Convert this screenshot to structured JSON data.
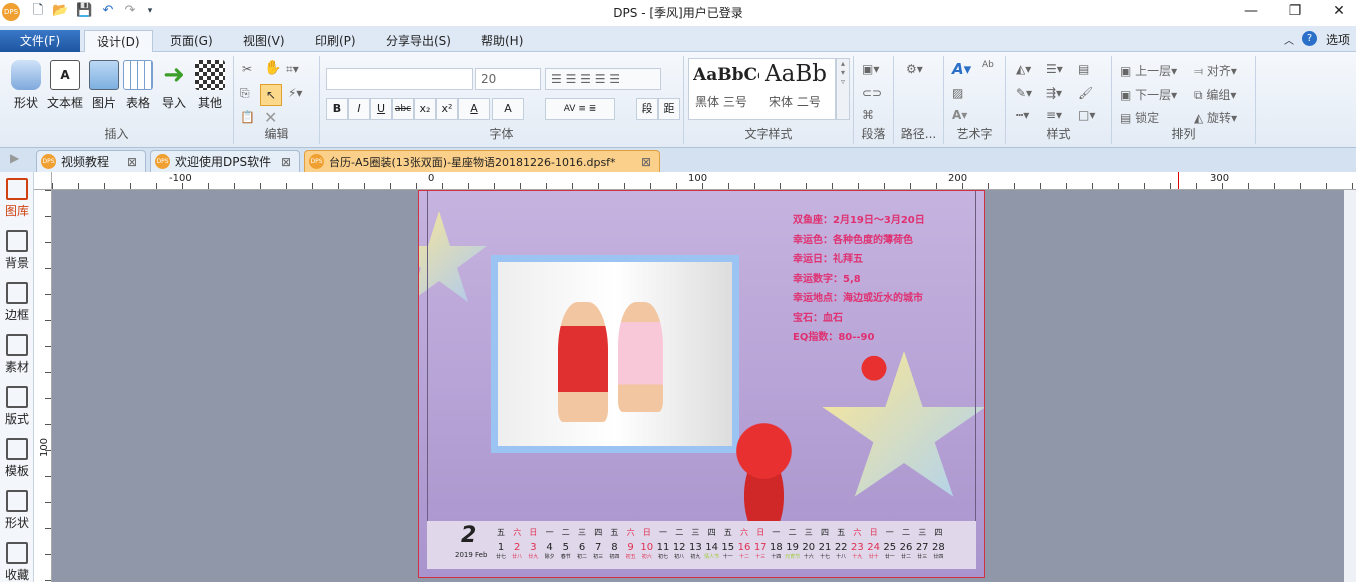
{
  "app": {
    "title": "DPS - [季风]用户已登录",
    "logo": "DPS"
  },
  "quick_access": [
    "new-icon",
    "open-icon",
    "save-icon",
    "undo-icon",
    "redo-icon",
    "customize-icon"
  ],
  "window_controls": {
    "minimize": "—",
    "restore": "❐",
    "close": "✕"
  },
  "menu": {
    "file": "文件(F)",
    "tabs": [
      "设计(D)",
      "页面(G)",
      "视图(V)",
      "印刷(P)",
      "分享导出(S)",
      "帮助(H)"
    ],
    "active": "设计(D)",
    "options": "选项"
  },
  "ribbon": {
    "insert": {
      "label": "插入",
      "items": [
        "形状",
        "文本框",
        "图片",
        "表格",
        "导入",
        "其他"
      ]
    },
    "edit": {
      "label": "编辑"
    },
    "font": {
      "label": "字体",
      "font_name": "",
      "font_size": "20",
      "buttons": [
        "B",
        "I",
        "U",
        "abc",
        "x₂",
        "x²",
        "A",
        "A"
      ],
      "para_buttons": [
        "段",
        "距"
      ]
    },
    "text_style": {
      "label": "文字样式",
      "styles": [
        {
          "preview": "AaBbCc",
          "name": "黑体 三号"
        },
        {
          "preview": "AaBb",
          "name": "宋体 二号"
        }
      ]
    },
    "paragraph": {
      "label": "段落"
    },
    "path": {
      "label": "路径..."
    },
    "art_text": {
      "label": "艺术字"
    },
    "style": {
      "label": "样式"
    },
    "arrange": {
      "label": "排列",
      "items": [
        "上一层",
        "对齐",
        "下一层",
        "编组",
        "锁定",
        "旋转"
      ]
    }
  },
  "doc_tabs": [
    {
      "label": "视频教程"
    },
    {
      "label": "欢迎使用DPS软件"
    },
    {
      "label": "台历-A5圈装(13张双面)-星座物语20181226-1016.dpsf*",
      "active": true
    }
  ],
  "ruler": {
    "h_labels": [
      "-100",
      "0",
      "100",
      "200",
      "300"
    ],
    "v_labels": [
      "100"
    ]
  },
  "sidebar": [
    {
      "label": "图库"
    },
    {
      "label": "背景"
    },
    {
      "label": "边框"
    },
    {
      "label": "素材"
    },
    {
      "label": "版式"
    },
    {
      "label": "模板"
    },
    {
      "label": "形状"
    },
    {
      "label": "收藏"
    }
  ],
  "page": {
    "info_lines": [
      "双鱼座：2月19日～3月20日",
      "幸运色：各种色度的薄荷色",
      "幸运日：礼拜五",
      "幸运数字：5,8",
      "幸运地点：海边或近水的城市",
      "宝石：血石",
      "EQ指数：80--90"
    ],
    "calendar": {
      "month": "2",
      "year_month": "2019 Feb",
      "weekdays": [
        "五",
        "六",
        "日",
        "一",
        "二",
        "三",
        "四",
        "五",
        "六",
        "日",
        "一",
        "二",
        "三",
        "四",
        "五",
        "六",
        "日",
        "一",
        "二",
        "三",
        "四",
        "五",
        "六",
        "日",
        "一",
        "二",
        "三",
        "四"
      ],
      "days": [
        "1",
        "2",
        "3",
        "4",
        "5",
        "6",
        "7",
        "8",
        "9",
        "10",
        "11",
        "12",
        "13",
        "14",
        "15",
        "16",
        "17",
        "18",
        "19",
        "20",
        "21",
        "22",
        "23",
        "24",
        "25",
        "26",
        "27",
        "28"
      ],
      "lunar": [
        "廿七",
        "廿八",
        "廿九",
        "除夕",
        "春节",
        "初二",
        "初三",
        "初四",
        "初五",
        "初六",
        "初七",
        "初八",
        "初九",
        "情人节",
        "十一",
        "十二",
        "十三",
        "十四",
        "元宵节",
        "十六",
        "十七",
        "十八",
        "十九",
        "廿十",
        "廿一",
        "廿二",
        "廿三",
        "廿四"
      ],
      "weekend_color": "#e03050",
      "holiday_color": "#9acd32"
    }
  }
}
